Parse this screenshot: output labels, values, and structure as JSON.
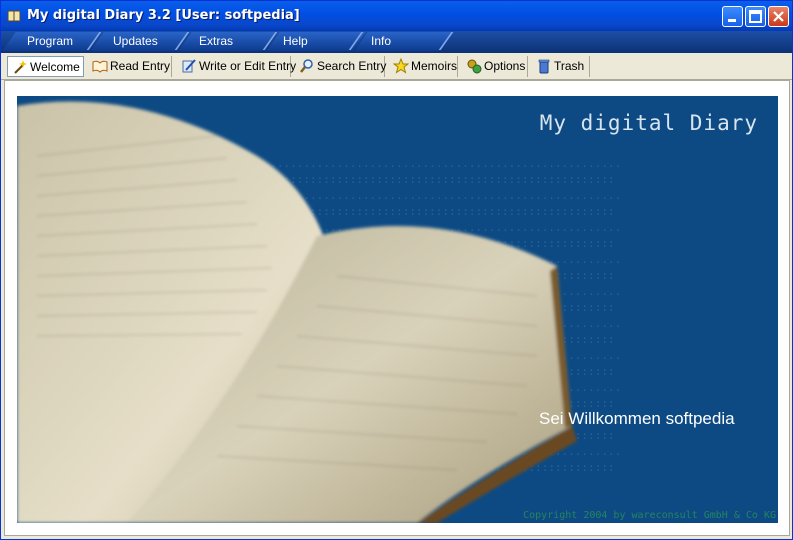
{
  "window": {
    "title": "My digital Diary 3.2  [User: softpedia]"
  },
  "menu": [
    {
      "label": "Program"
    },
    {
      "label": "Updates"
    },
    {
      "label": "Extras"
    },
    {
      "label": "Help"
    },
    {
      "label": "Info"
    }
  ],
  "tabs": [
    {
      "label": "Welcome",
      "icon": "wand-icon",
      "active": true
    },
    {
      "label": "Read Entry",
      "icon": "open-book-icon"
    },
    {
      "label": "Write or Edit Entry",
      "icon": "pencil-icon"
    },
    {
      "label": "Search Entry",
      "icon": "magnifier-icon"
    },
    {
      "label": "Memoirs",
      "icon": "star-icon"
    },
    {
      "label": "Options",
      "icon": "gears-icon"
    },
    {
      "label": "Trash",
      "icon": "trash-icon"
    }
  ],
  "banner": {
    "title": "My digital Diary",
    "welcome": "Sei Willkommen softpedia",
    "copyright": "Copyright 2004 by wareconsult GmbH & Co KG"
  },
  "colors": {
    "banner_bg": "#0d4a83",
    "menubar_bg": "#0c3275",
    "titlebar_bg": "#0050e6"
  }
}
